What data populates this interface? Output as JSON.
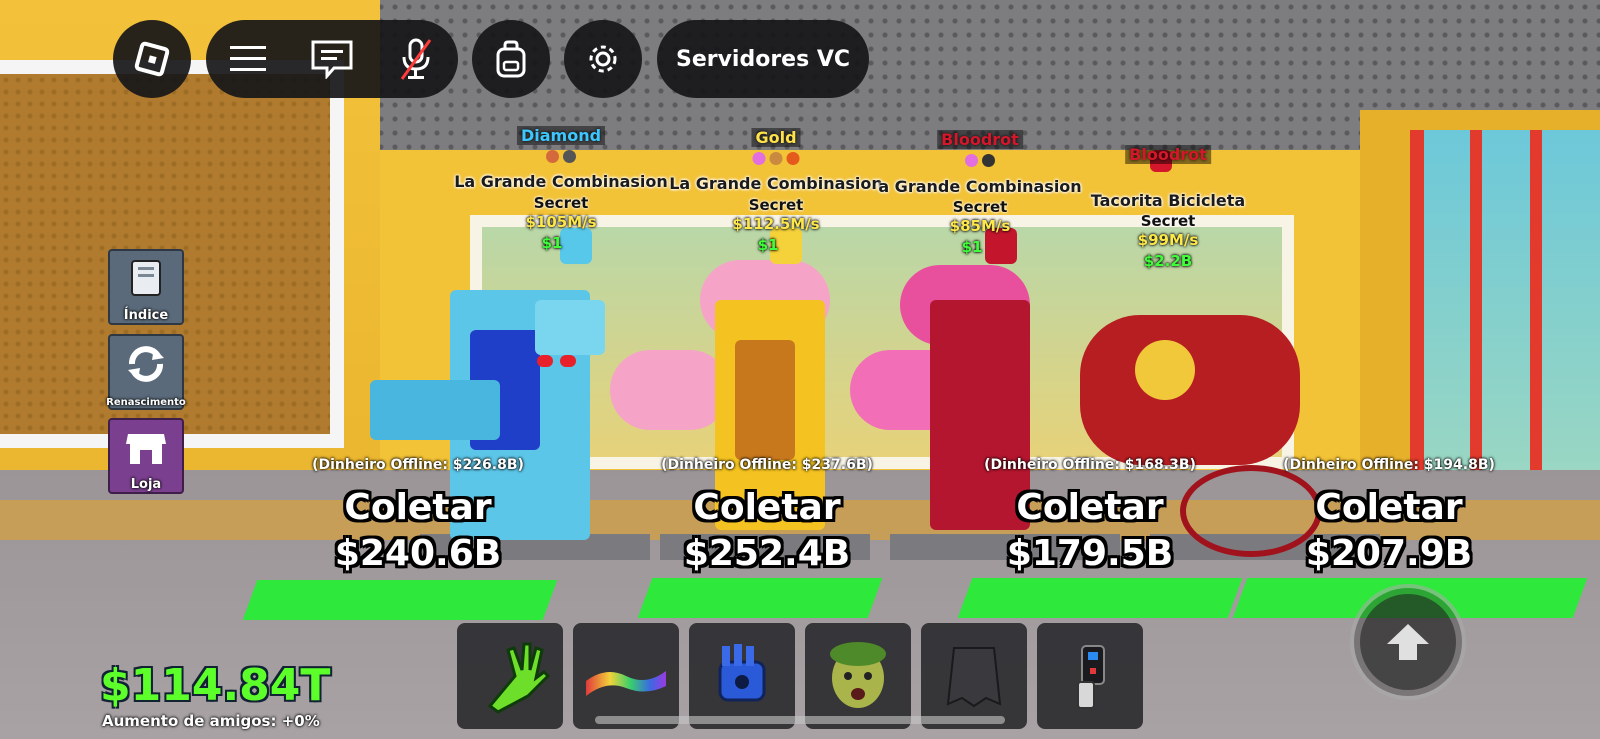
{
  "topbar": {
    "roblox_icon": "roblox-logo-icon",
    "server_label": "Servidores VC"
  },
  "side_buttons": [
    {
      "label": "Índice",
      "icon": "book-icon"
    },
    {
      "label": "Renascimento",
      "icon": "rebirth-icon"
    },
    {
      "label": "Loja",
      "icon": "shop-icon"
    }
  ],
  "pets": [
    {
      "rarity": "Diamond",
      "name": "La Grande Combinasion",
      "tier": "Secret",
      "rate": "$105M/s",
      "price": "$1",
      "offline": "(Dinheiro Offline: $226.8B)",
      "collect": "Coletar",
      "collect_amount": "$240.6B"
    },
    {
      "rarity": "Gold",
      "name": "La Grande Combinasion",
      "tier": "Secret",
      "rate": "$112.5M/s",
      "price": "$1",
      "offline": "(Dinheiro Offline: $237.6B)",
      "collect": "Coletar",
      "collect_amount": "$252.4B"
    },
    {
      "rarity": "Bloodrot",
      "name": "a Grande Combinasion",
      "tier": "Secret",
      "rate": "$85M/s",
      "price": "$1",
      "offline": "(Dinheiro Offline: $168.3B)",
      "collect": "Coletar",
      "collect_amount": "$179.5B"
    },
    {
      "rarity": "Bloodrot",
      "name": "Tacorita Bicicleta",
      "tier": "Secret",
      "rate": "$99M/s",
      "price": "$2.2B",
      "offline": "(Dinheiro Offline: $194.8B)",
      "collect": "Coletar",
      "collect_amount": "$207.9B"
    }
  ],
  "player": {
    "money": "$114.84T",
    "friend_boost": "Aumento de amigos: +0%"
  },
  "hotbar": [
    "slap-glove-icon",
    "magic-carpet-icon",
    "power-glove-icon",
    "medusa-head-icon",
    "invisibility-cloak-icon",
    "laser-gun-icon"
  ],
  "colors": {
    "money": "#5dff2a",
    "diamond": "#3cc8ff",
    "gold": "#ffe14a",
    "bloodrot": "#d4172a",
    "pad": "#2fe83c"
  }
}
